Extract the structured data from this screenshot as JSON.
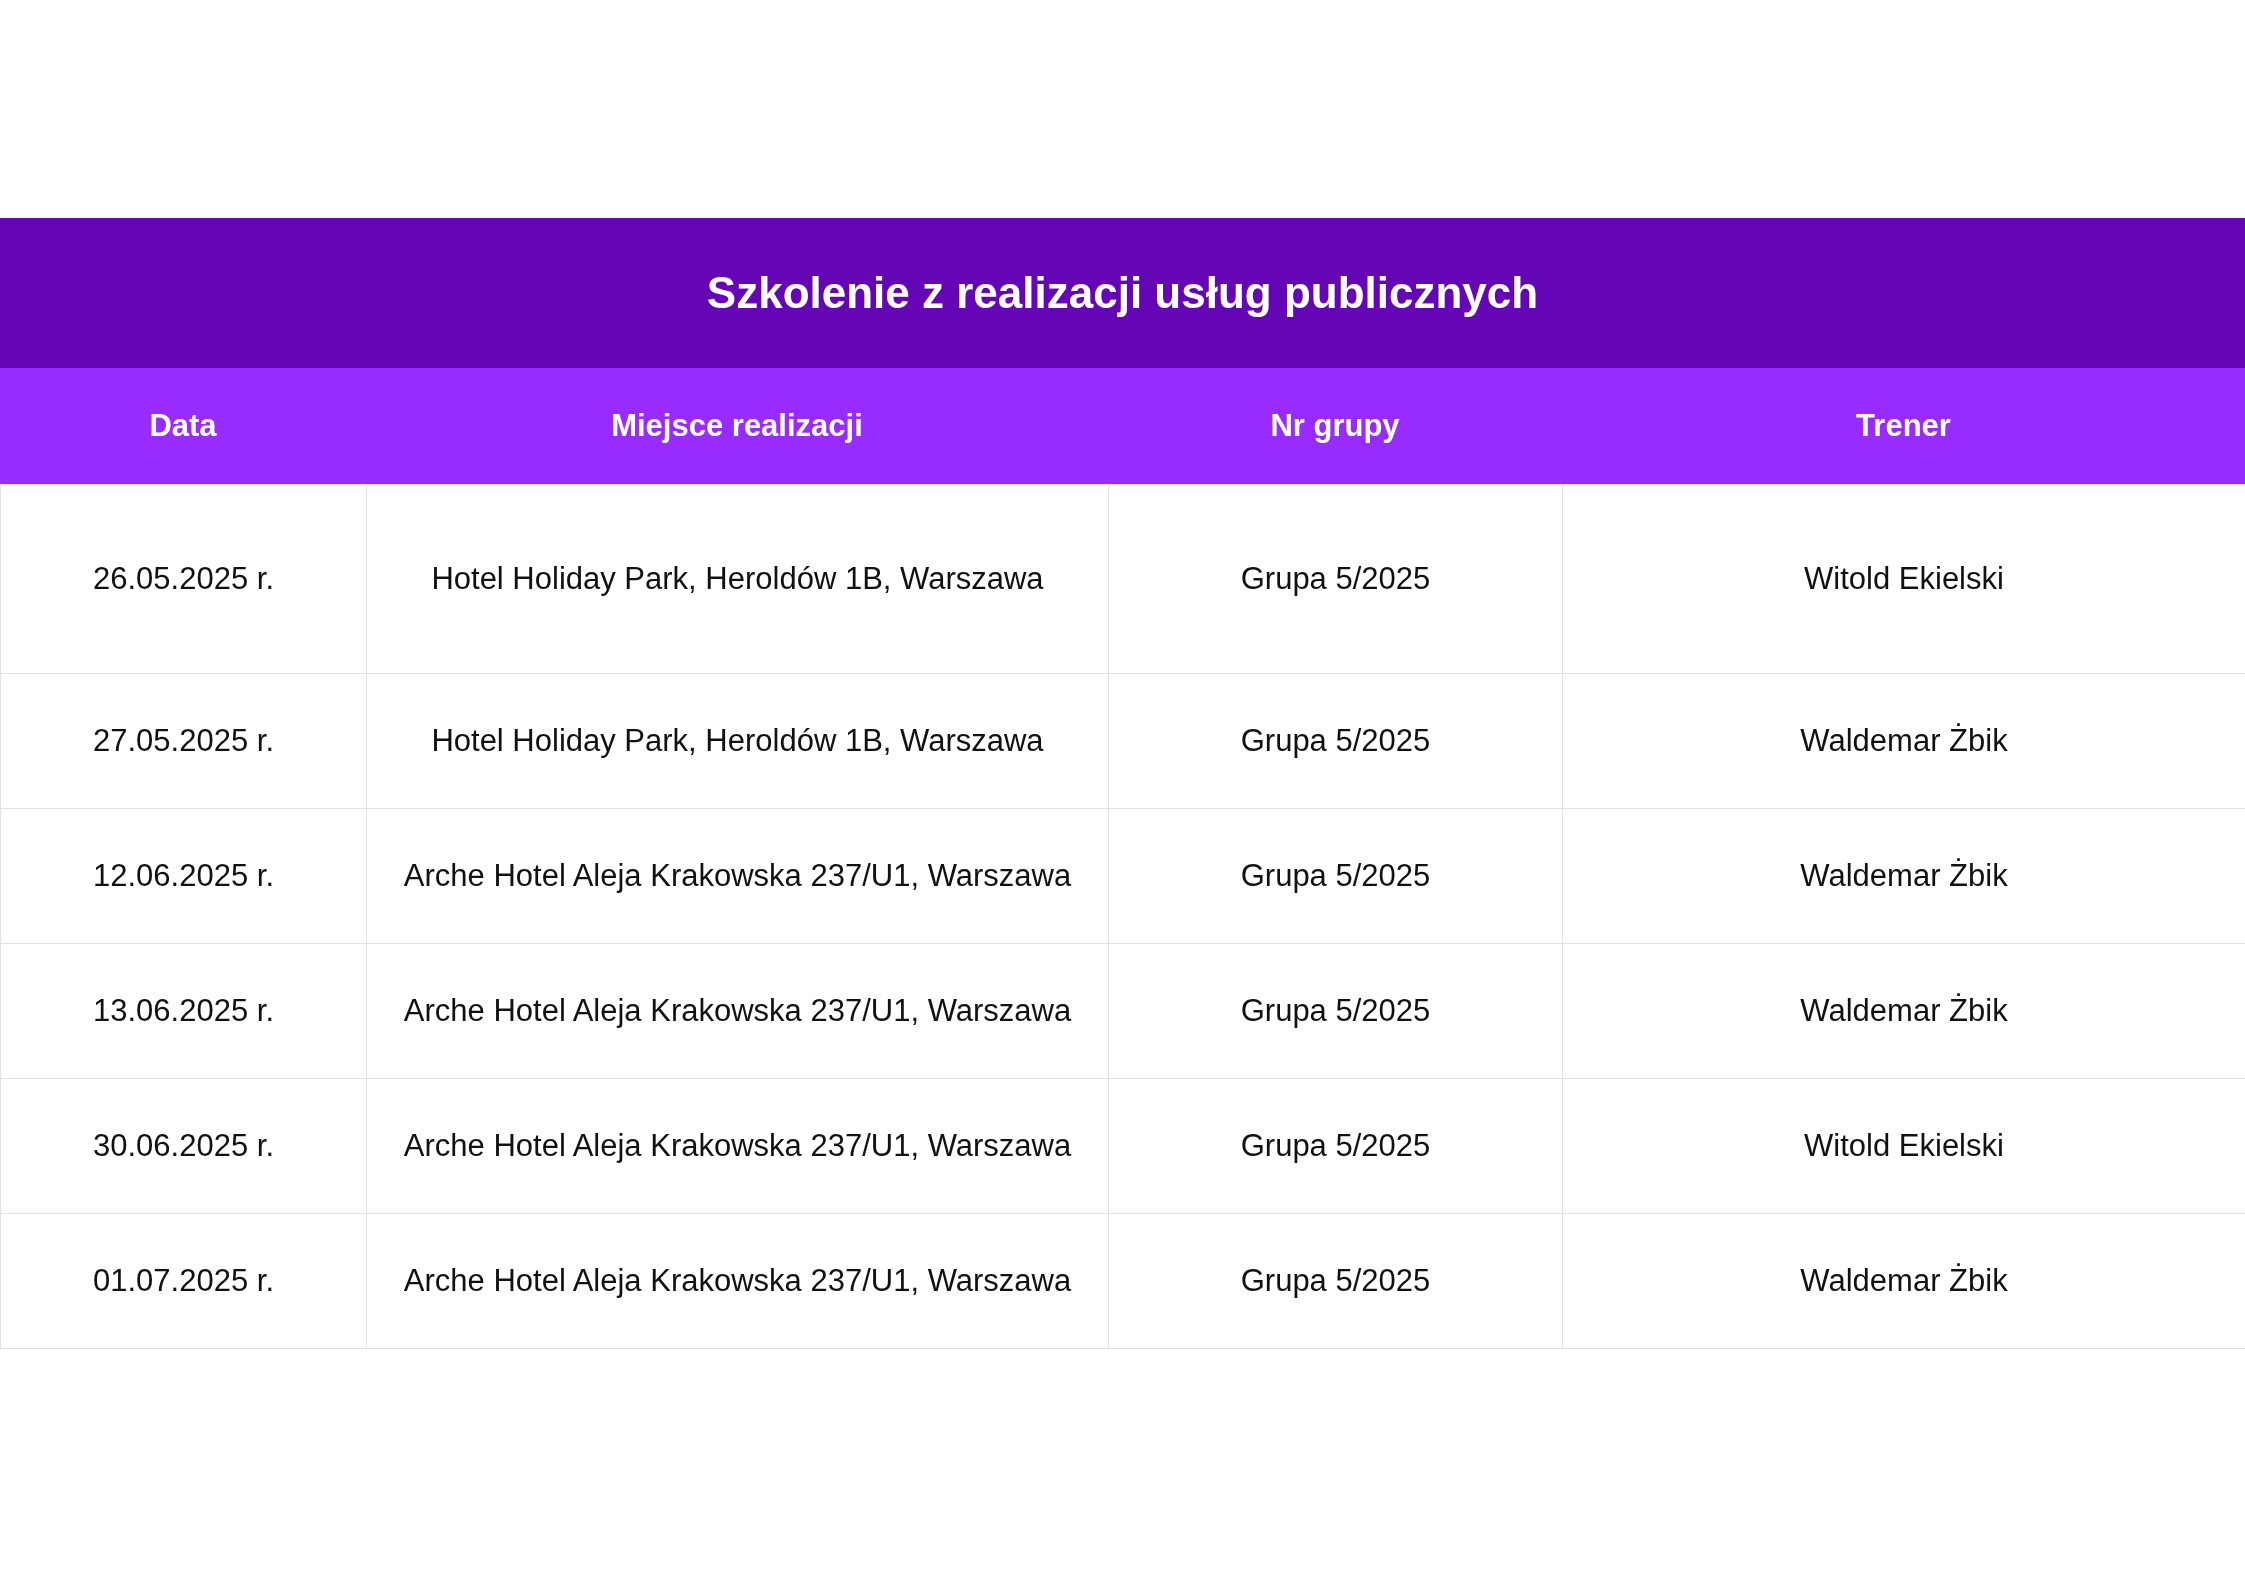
{
  "table": {
    "title": "Szkolenie z realizacji usług publicznych",
    "columns": [
      "Data",
      "Miejsce realizacji",
      "Nr grupy",
      "Trener"
    ],
    "rows": [
      {
        "cells": [
          "26.05.2025 r.",
          "Hotel Holiday Park, Heroldów 1B, Warszawa",
          "Grupa 5/2025",
          "Witold Ekielski"
        ]
      },
      {
        "cells": [
          "27.05.2025 r.",
          "Hotel Holiday Park, Heroldów 1B, Warszawa",
          "Grupa 5/2025",
          "Waldemar Żbik"
        ]
      },
      {
        "cells": [
          "12.06.2025 r.",
          "Arche Hotel Aleja Krakowska 237/U1, Warszawa",
          "Grupa 5/2025",
          "Waldemar Żbik"
        ]
      },
      {
        "cells": [
          "13.06.2025 r.",
          "Arche Hotel Aleja Krakowska 237/U1, Warszawa",
          "Grupa 5/2025",
          "Waldemar Żbik"
        ]
      },
      {
        "cells": [
          "30.06.2025 r.",
          "Arche Hotel Aleja Krakowska 237/U1, Warszawa",
          "Grupa 5/2025",
          "Witold Ekielski"
        ]
      },
      {
        "cells": [
          "01.07.2025 r.",
          "Arche Hotel Aleja Krakowska 237/U1, Warszawa",
          "Grupa 5/2025",
          "Waldemar Żbik"
        ]
      }
    ]
  }
}
